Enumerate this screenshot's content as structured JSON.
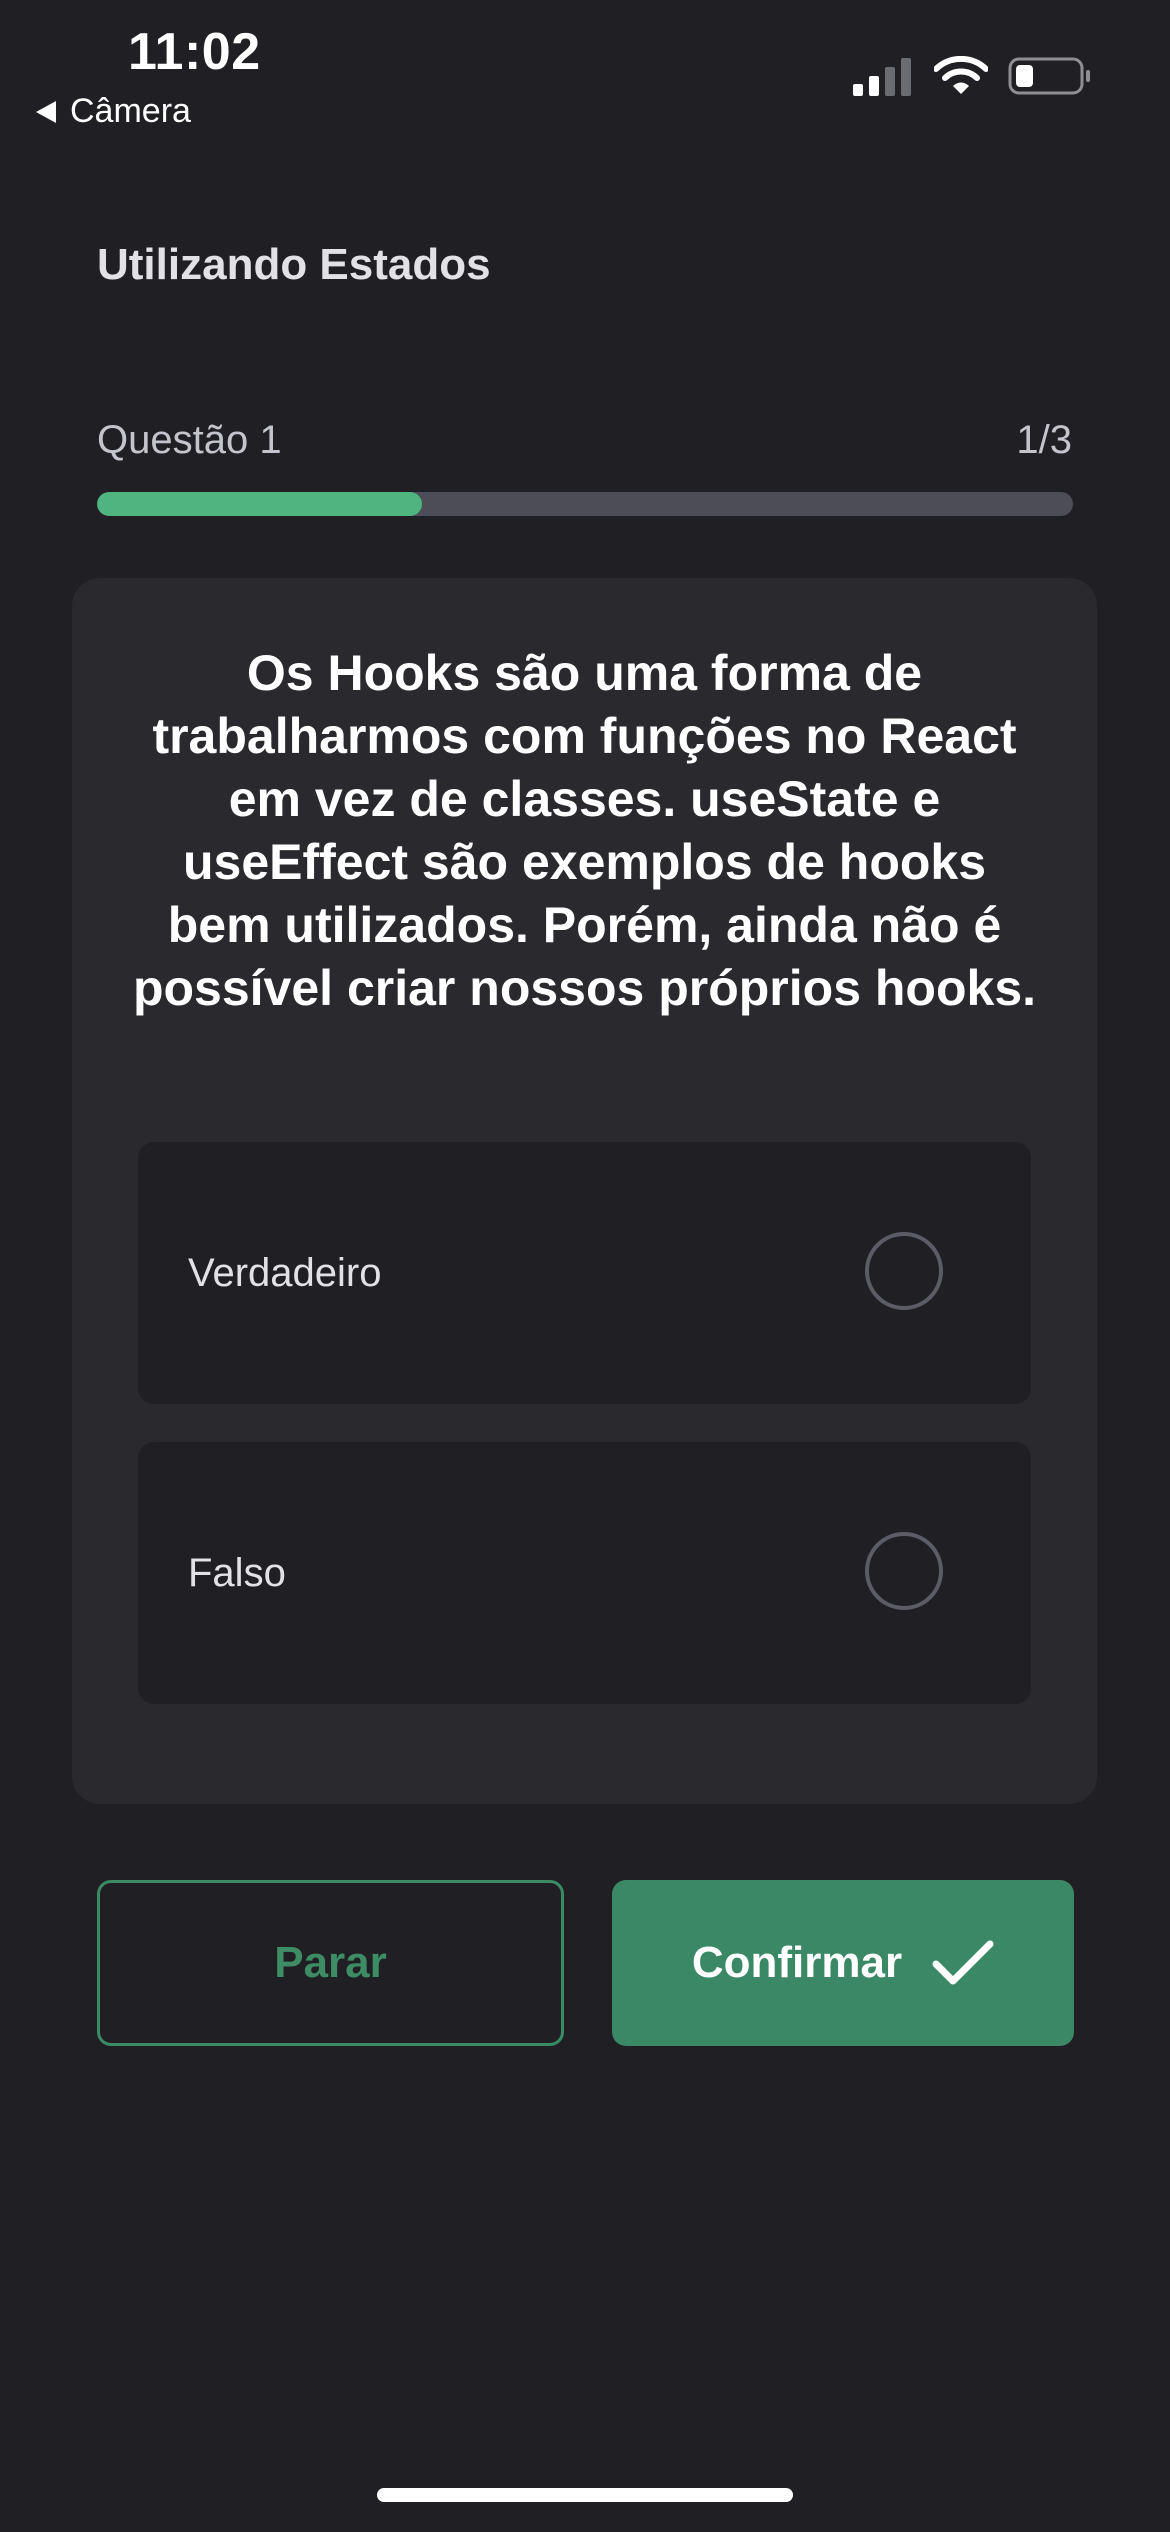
{
  "status_bar": {
    "time": "11:02",
    "back_label": "Câmera"
  },
  "header": {
    "title": "Utilizando Estados"
  },
  "progress": {
    "question_label": "Questão 1",
    "count": "1/3",
    "fraction": 0.333,
    "color": "#4fb47f"
  },
  "question": {
    "text": "Os Hooks são uma forma de trabalharmos com funções no React em vez de classes. useState e useEffect são exemplos de hooks bem utilizados. Porém, ainda não é possível criar nossos próprios hooks.",
    "options": [
      {
        "label": "Verdadeiro",
        "selected": false
      },
      {
        "label": "Falso",
        "selected": false
      }
    ]
  },
  "actions": {
    "stop_label": "Parar",
    "confirm_label": "Confirmar",
    "confirm_icon": "check-icon"
  },
  "colors": {
    "background": "#202024",
    "card": "#29292e",
    "accent": "#3b8866"
  }
}
